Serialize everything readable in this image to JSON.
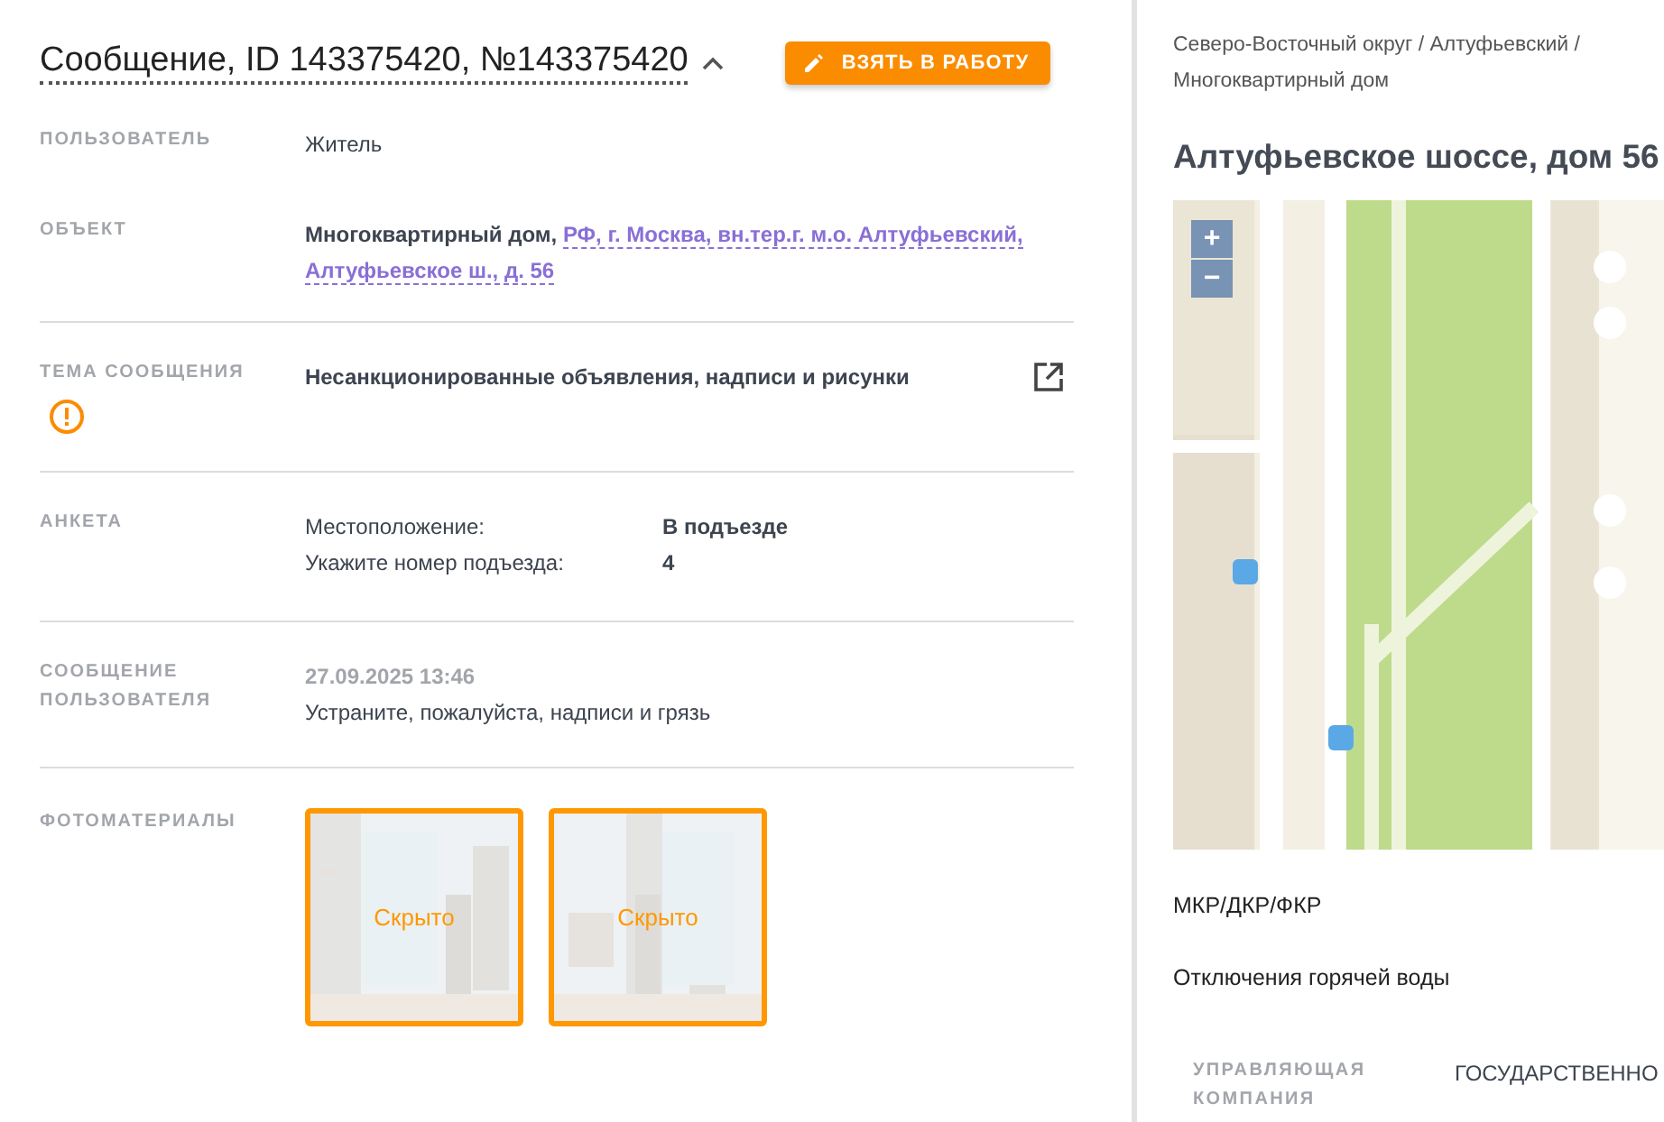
{
  "header": {
    "title": "Сообщение, ID 143375420, №143375420",
    "expanded": true,
    "action_button": "ВЗЯТЬ В РАБОТУ"
  },
  "fields": [
    {
      "kind": "text",
      "label": "ПОЛЬЗОВАТЕЛЬ",
      "value": "Житель"
    },
    {
      "kind": "object",
      "label": "ОБЪЕКТ",
      "object_type": "Многоквартирный дом,",
      "address_link_lines": [
        "РФ, г. Москва, вн.тер.г. м.о. Алтуфьевский,",
        "Алтуфьевское ш., д. 56"
      ]
    },
    {
      "kind": "topic",
      "label": "ТЕМА СООБЩЕНИЯ",
      "value": "Несанкционированные объявления, надписи и рисунки",
      "warning": true
    },
    {
      "kind": "survey",
      "label": "АНКЕТА",
      "answers": [
        {
          "question": "Местоположение:",
          "answer": "В подъезде"
        },
        {
          "question": "Укажите номер подъезда:",
          "answer": "4"
        }
      ]
    },
    {
      "kind": "message",
      "label": "СООБЩЕНИЕ ПОЛЬЗОВАТЕЛЯ",
      "date": "27.09.2025 13:46",
      "value": "Устраните, пожалуйста, надписи и грязь"
    },
    {
      "kind": "photos",
      "label": "ФОТОМАТЕРИАЛЫ",
      "photos": [
        {
          "kind": "picture",
          "caption": "Скрыто"
        },
        {
          "kind": "picture",
          "caption": "Скрыто"
        }
      ]
    }
  ],
  "side": {
    "breadcrumb": "Северо-Восточный округ / Алтуфьевский / Многоквартирный дом",
    "address": "Алтуфьевское шоссе, дом 56",
    "map": {
      "zoom_in": "+",
      "zoom_out": "−"
    },
    "sections": [
      "МКР/ДКР/ФКР",
      "Отключения горячей воды"
    ],
    "info_rows": [
      {
        "label": "УПРАВЛЯЮЩАЯ КОМПАНИЯ",
        "value": "ГОСУДАРСТВЕННО"
      }
    ]
  }
}
